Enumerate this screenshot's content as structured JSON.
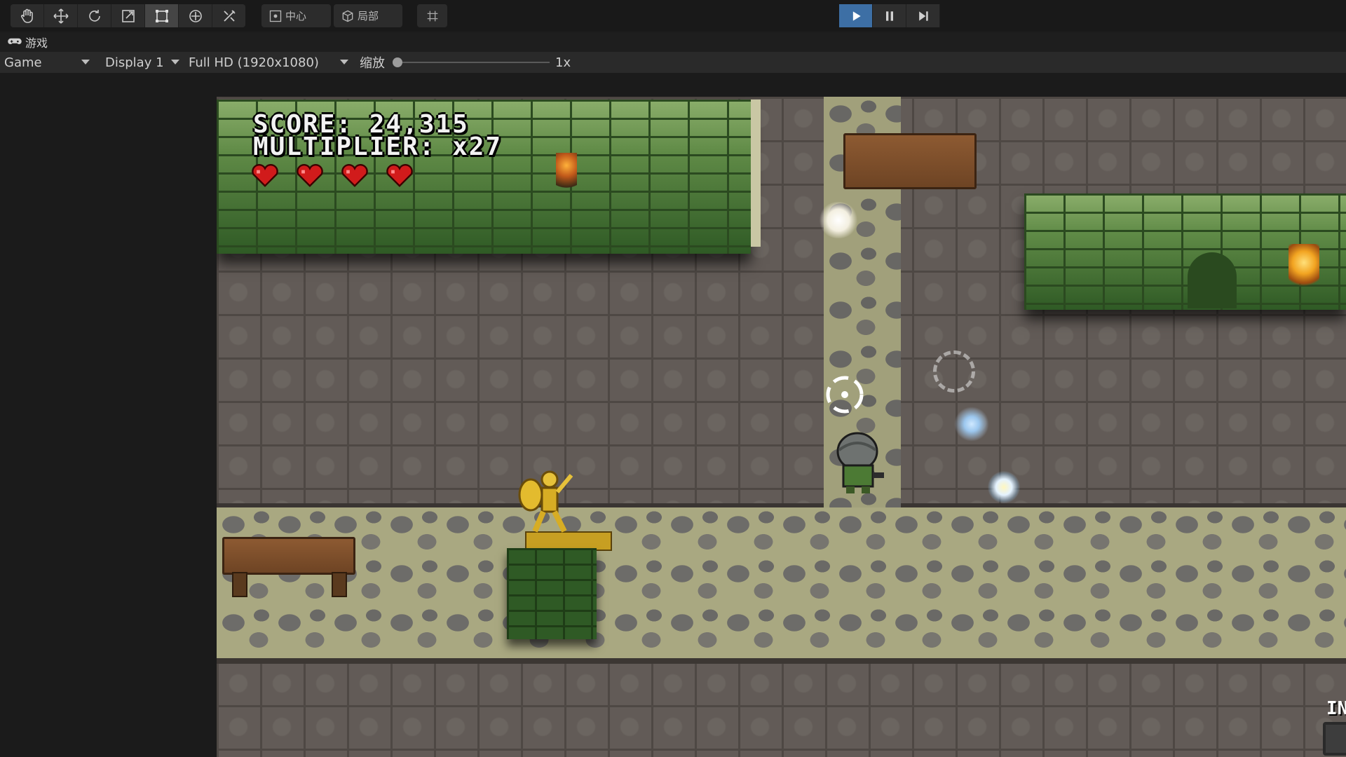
{
  "toolbar": {
    "tools": [
      {
        "name": "hand-tool",
        "icon": "hand-icon"
      },
      {
        "name": "move-tool",
        "icon": "move-icon"
      },
      {
        "name": "rotate-tool",
        "icon": "rotate-icon"
      },
      {
        "name": "scale-tool",
        "icon": "scale-icon"
      },
      {
        "name": "rect-tool",
        "icon": "rect-icon",
        "active": true
      },
      {
        "name": "transform-tool",
        "icon": "transform-icon"
      },
      {
        "name": "custom-tool",
        "icon": "tools-icon"
      }
    ],
    "pivot_label": "中心",
    "space_label": "局部",
    "snap_icon": "grid-snap-icon",
    "play_icon": "play-icon",
    "pause_icon": "pause-icon",
    "step_icon": "step-icon",
    "accent_color": "#3d6fa5"
  },
  "game_tab": {
    "label": "游戏",
    "icon": "gamepad-icon"
  },
  "game_view": {
    "mode": "Game",
    "display": "Display 1",
    "resolution": "Full HD (1920x1080)",
    "scale_label": "缩放",
    "scale_value": "1x",
    "scale_fraction": 0.0
  },
  "hud": {
    "score": "SCORE: 24,315",
    "multiplier": "MULTIPLIER: x27",
    "hearts": 4,
    "heart_color": "#d11b1b",
    "corner_text": "IN"
  }
}
